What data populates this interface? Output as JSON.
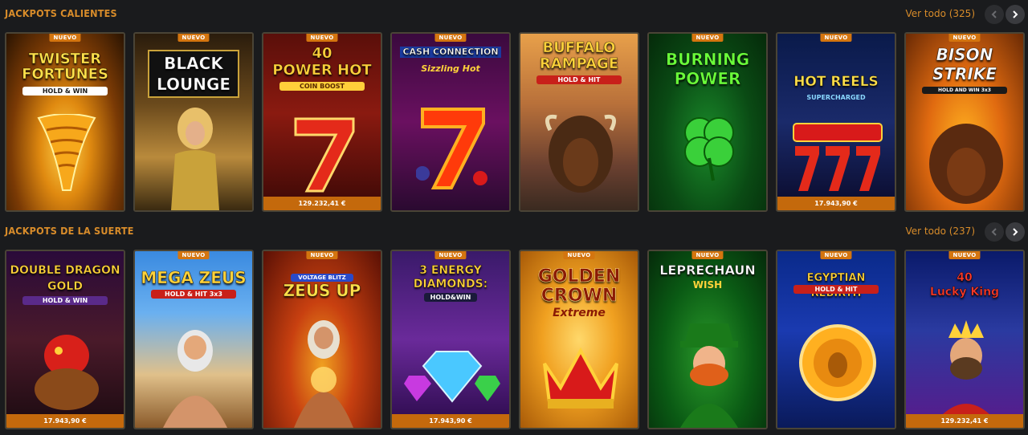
{
  "sections": [
    {
      "title": "JACKPOTS CALIENTES",
      "view_all": "Ver todo (325)",
      "games": [
        {
          "name": "TWISTER\nFORTUNES",
          "subtitle": "HOLD & WIN",
          "badge": "NUEVO",
          "jackpot": ""
        },
        {
          "name": "BLACK\nLOUNGE",
          "subtitle": "",
          "badge": "NUEVO",
          "jackpot": ""
        },
        {
          "name": "40\nPOWER HOT",
          "subtitle": "COIN BOOST",
          "badge": "NUEVO",
          "jackpot": "129.232,41 €"
        },
        {
          "name": "CASH CONNECTION",
          "subtitle": "Sizzling Hot",
          "badge": "NUEVO",
          "jackpot": ""
        },
        {
          "name": "BUFFALO\nRAMPAGE",
          "subtitle": "HOLD & HIT",
          "badge": "",
          "jackpot": ""
        },
        {
          "name": "BURNING\nPOWER",
          "subtitle": "",
          "badge": "NUEVO",
          "jackpot": ""
        },
        {
          "name": "HOT REELS",
          "subtitle": "SUPERCHARGED",
          "badge": "NUEVO",
          "jackpot": "17.943,90 €"
        },
        {
          "name": "BISON\nSTRIKE",
          "subtitle": "HOLD AND WIN 3x3",
          "badge": "NUEVO",
          "jackpot": ""
        }
      ]
    },
    {
      "title": "JACKPOTS DE LA SUERTE",
      "view_all": "Ver todo (237)",
      "games": [
        {
          "name": "DOUBLE DRAGON\nGOLD",
          "subtitle": "HOLD & WIN",
          "badge": "",
          "jackpot": "17.943,90 €"
        },
        {
          "name": "MEGA ZEUS",
          "subtitle": "HOLD & HIT 3x3",
          "badge": "NUEVO",
          "jackpot": ""
        },
        {
          "name": "ZEUS UP",
          "subtitle": "VOLTAGE BLITZ",
          "badge": "NUEVO",
          "jackpot": ""
        },
        {
          "name": "3 ENERGY\nDIAMONDS:",
          "subtitle": "HOLD&WIN",
          "badge": "NUEVO",
          "jackpot": "17.943,90 €"
        },
        {
          "name": "GOLDEN\nCROWN",
          "subtitle": "Extreme",
          "badge": "NUEVO",
          "jackpot": ""
        },
        {
          "name": "LEPRECHAUN",
          "subtitle": "WISH",
          "badge": "NUEVO",
          "jackpot": ""
        },
        {
          "name": "EGYPTIAN REBIRTH",
          "subtitle": "HOLD & HIT",
          "badge": "NUEVO",
          "jackpot": ""
        },
        {
          "name": "40\nLucky King",
          "subtitle": "",
          "badge": "NUEVO",
          "jackpot": "129.232,41 €"
        }
      ]
    }
  ],
  "colors": {
    "background": "#1a1b1d",
    "accent": "#d88c2a",
    "badge": "#d4750f",
    "jackpot_bar": "#c4690c"
  },
  "icons": {
    "prev": "chevron-left-icon",
    "next": "chevron-right-icon"
  }
}
